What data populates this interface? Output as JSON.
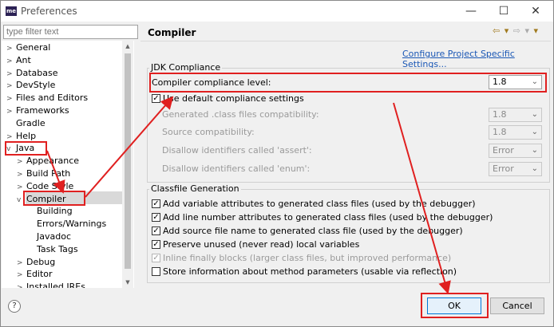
{
  "window": {
    "title": "Preferences",
    "app_icon_text": "me",
    "minimize": "—",
    "maximize": "☐",
    "close": "✕"
  },
  "sidebar": {
    "filter_placeholder": "type filter text",
    "tree": [
      {
        "label": "General",
        "twisty": ">"
      },
      {
        "label": "Ant",
        "twisty": ">"
      },
      {
        "label": "Database",
        "twisty": ">"
      },
      {
        "label": "DevStyle",
        "twisty": ">"
      },
      {
        "label": "Files and Editors",
        "twisty": ">"
      },
      {
        "label": "Frameworks",
        "twisty": ">"
      },
      {
        "label": "Gradle",
        "twisty": ""
      },
      {
        "label": "Help",
        "twisty": ">"
      },
      {
        "label": "Java",
        "twisty": "v"
      },
      {
        "label": "Appearance",
        "twisty": ">"
      },
      {
        "label": "Build Path",
        "twisty": ">"
      },
      {
        "label": "Code Style",
        "twisty": ">"
      },
      {
        "label": "Compiler",
        "twisty": "v"
      },
      {
        "label": "Building",
        "twisty": ""
      },
      {
        "label": "Errors/Warnings",
        "twisty": ""
      },
      {
        "label": "Javadoc",
        "twisty": ""
      },
      {
        "label": "Task Tags",
        "twisty": ""
      },
      {
        "label": "Debug",
        "twisty": ">"
      },
      {
        "label": "Editor",
        "twisty": ">"
      },
      {
        "label": "Installed JREs",
        "twisty": ">"
      }
    ]
  },
  "page": {
    "title": "Compiler",
    "configure_link": "Configure Project Specific Settings...",
    "jdk_group": {
      "label": "JDK Compliance",
      "compliance_label": "Compiler compliance level:",
      "compliance_value": "1.8",
      "use_default_label": "Use default compliance settings",
      "generated_label": "Generated .class files compatibility:",
      "generated_value": "1.8",
      "source_label": "Source compatibility:",
      "source_value": "1.8",
      "assert_label": "Disallow identifiers called 'assert':",
      "assert_value": "Error",
      "enum_label": "Disallow identifiers called 'enum':",
      "enum_value": "Error"
    },
    "classfile_group": {
      "label": "Classfile Generation",
      "options": [
        {
          "label": "Add variable attributes to generated class files (used by the debugger)",
          "checked": true,
          "disabled": false
        },
        {
          "label": "Add line number attributes to generated class files (used by the debugger)",
          "checked": true,
          "disabled": false
        },
        {
          "label": "Add source file name to generated class file (used by the debugger)",
          "checked": true,
          "disabled": false
        },
        {
          "label": "Preserve unused (never read) local variables",
          "checked": true,
          "disabled": false
        },
        {
          "label": "Inline finally blocks (larger class files, but improved performance)",
          "checked": true,
          "disabled": true
        },
        {
          "label": "Store information about method parameters (usable via reflection)",
          "checked": false,
          "disabled": false
        }
      ]
    }
  },
  "buttons": {
    "help": "?",
    "ok": "OK",
    "cancel": "Cancel"
  },
  "colors": {
    "annotation": "#e02020",
    "link": "#1a57b5",
    "selection": "#d9d9d9"
  }
}
